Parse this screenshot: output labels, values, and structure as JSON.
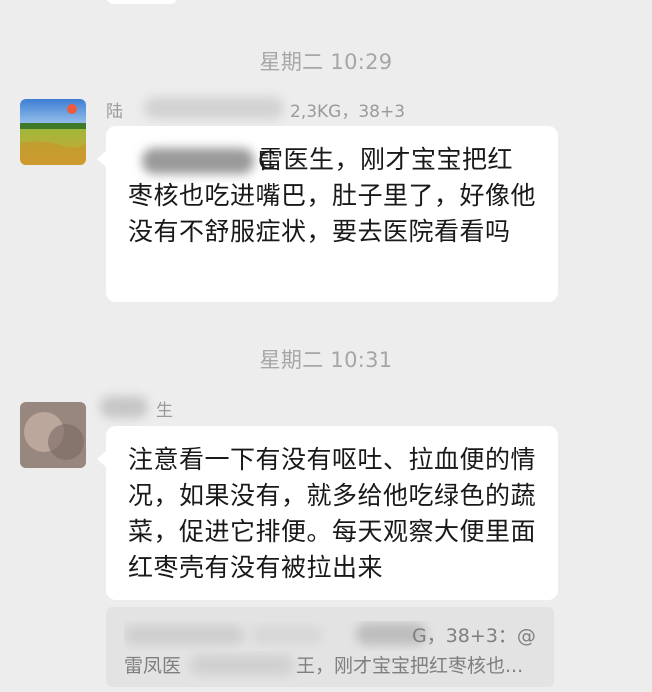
{
  "chat": {
    "messages": [
      {
        "timestamp": "星期二 10:29",
        "sender": "陆",
        "sender_suffix": "2,3KG，38+3",
        "text_prefix": "C",
        "text": "雷医生，刚才宝宝把红枣核也吃进嘴巴，肚子里了，好像他没有不舒服症状，要去医院看看吗"
      },
      {
        "timestamp": "星期二 10:31",
        "sender_suffix": "生",
        "text": "注意看一下有没有呕吐、拉血便的情况，如果没有，就多给他吃绿色的蔬菜，促进它排便。每天观察大便里面红枣壳有没有被拉出来",
        "quote": {
          "line1_suffix": "G，38+3：@",
          "line2_prefix": "雷凤医",
          "line2_suffix": "王，刚才宝宝把红枣核也..."
        }
      }
    ]
  },
  "colors": {
    "background": "#ededed",
    "bubble": "#ffffff",
    "timestamp_text": "#a6a6a6",
    "quote_background": "#e3e3e3"
  }
}
